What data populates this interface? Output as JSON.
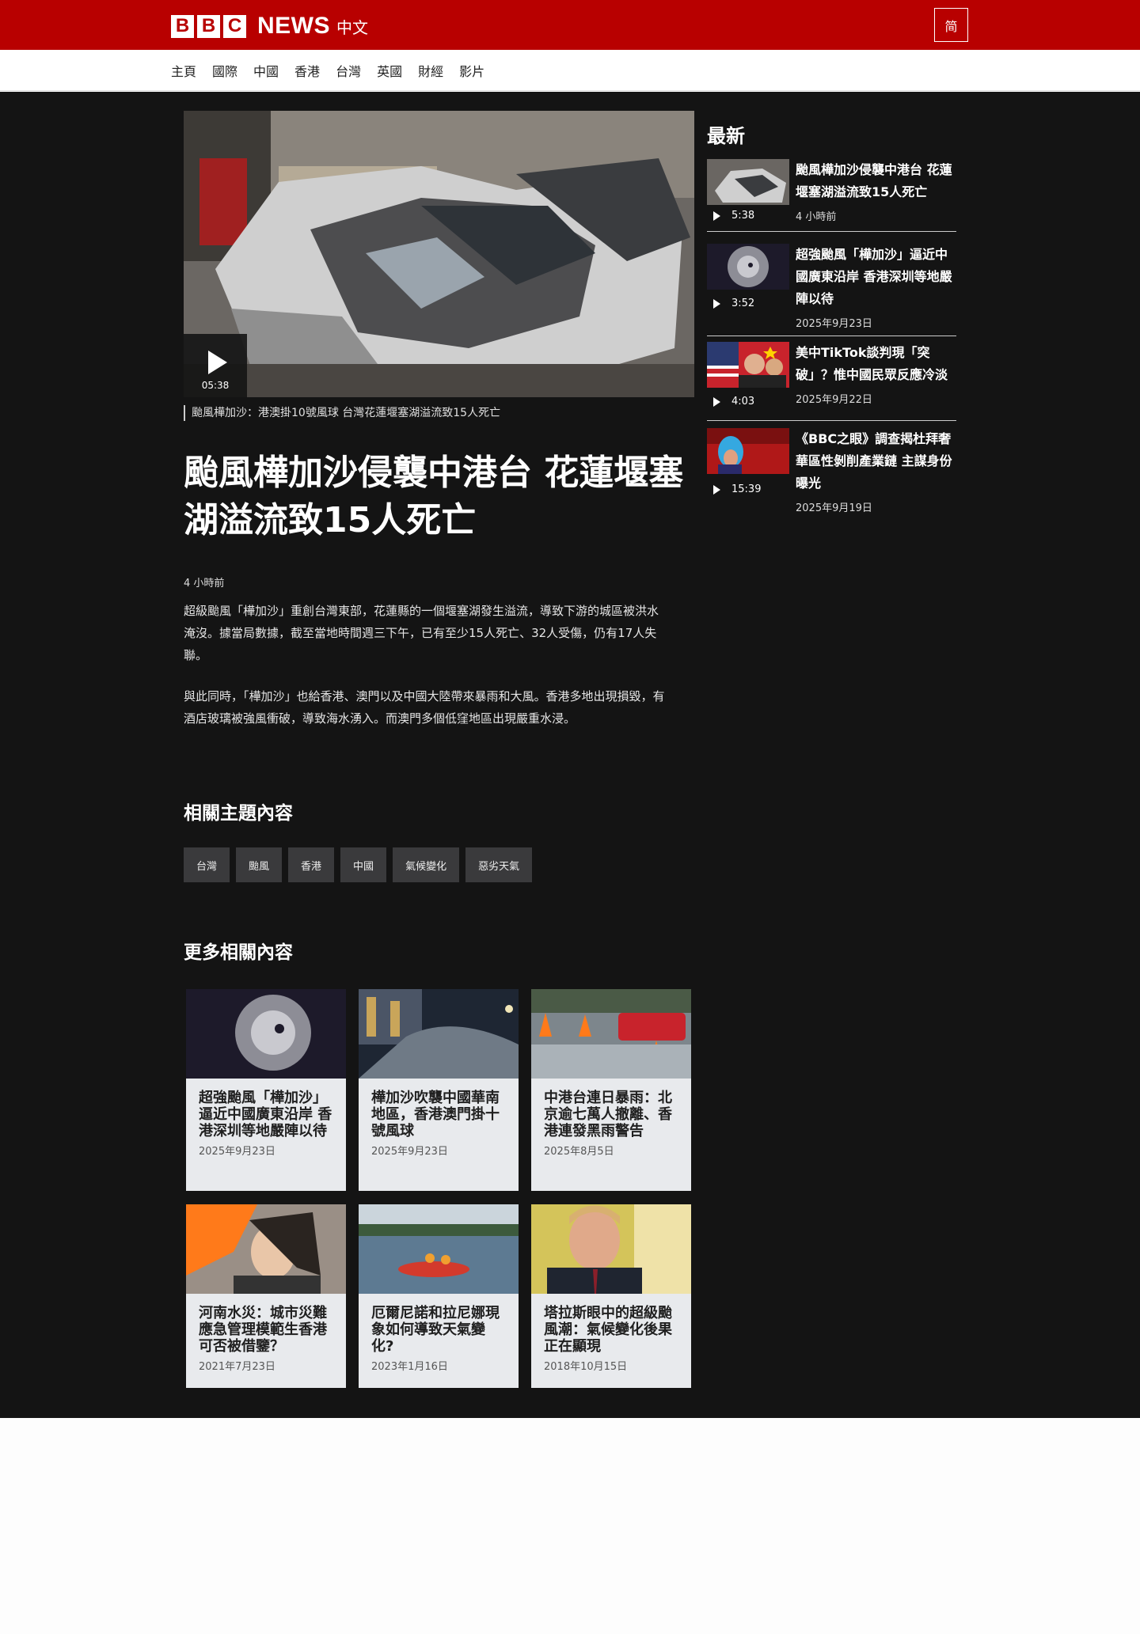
{
  "header": {
    "logo_letters": [
      "B",
      "B",
      "C"
    ],
    "logo_news": "NEWS",
    "logo_lang": "中文",
    "script_toggle": "简"
  },
  "nav": {
    "items": [
      "主頁",
      "國際",
      "中國",
      "香港",
      "台灣",
      "英國",
      "財經",
      "影片"
    ]
  },
  "hero": {
    "duration": "05:38",
    "caption": "颱風樺加沙：港澳掛10號風球 台灣花蓮堰塞湖溢流致15人死亡"
  },
  "article": {
    "headline": "颱風樺加沙侵襲中港台 花蓮堰塞湖溢流致15人死亡",
    "timestamp": "4 小時前",
    "paragraphs": [
      "超級颱風「樺加沙」重創台灣東部，花蓮縣的一個堰塞湖發生溢流，導致下游的城區被洪水淹沒。據當局數據，截至當地時間週三下午，已有至少15人死亡、32人受傷，仍有17人失聯。",
      "與此同時，「樺加沙」也給香港、澳門以及中國大陸帶來暴雨和大風。香港多地出現損毀，有酒店玻璃被強風衝破，導致海水湧入。而澳門多個低窪地區出現嚴重水浸。"
    ]
  },
  "topics": {
    "title": "相關主題內容",
    "tags": [
      "台灣",
      "颱風",
      "香港",
      "中國",
      "氣候變化",
      "惡劣天氣"
    ]
  },
  "more": {
    "title": "更多相關內容",
    "cards": [
      {
        "title": "超強颱風「樺加沙」逼近中國廣東沿岸 香港深圳等地嚴陣以待",
        "date": "2025年9月23日"
      },
      {
        "title": "樺加沙吹襲中國華南地區，香港澳門掛十號風球",
        "date": "2025年9月23日"
      },
      {
        "title": "中港台連日暴雨：北京逾七萬人撤離、香港連發黑雨警告",
        "date": "2025年8月5日"
      },
      {
        "title": "河南水災：城市災難應急管理模範生香港可否被借鑒？",
        "date": "2021年7月23日"
      },
      {
        "title": "厄爾尼諾和拉尼娜現象如何導致天氣變化?",
        "date": "2023年1月16日"
      },
      {
        "title": "塔拉斯眼中的超級颱風潮：氣候變化後果正在顯現",
        "date": "2018年10月15日"
      }
    ]
  },
  "sidebar": {
    "title": "最新",
    "items": [
      {
        "headline": "颱風樺加沙侵襲中港台 花蓮堰塞湖溢流致15人死亡",
        "duration": "5:38",
        "date": "4 小時前"
      },
      {
        "headline": "超強颱風「樺加沙」逼近中國廣東沿岸 香港深圳等地嚴陣以待",
        "duration": "3:52",
        "date": "2025年9月23日"
      },
      {
        "headline": "美中TikTok談判現「突破」？惟中國民眾反應冷淡",
        "duration": "4:03",
        "date": "2025年9月22日"
      },
      {
        "headline": "《BBC之眼》調查揭杜拜奢華區性剝削產業鏈 主謀身份曝光",
        "duration": "15:39",
        "date": "2025年9月19日"
      }
    ]
  },
  "colors": {
    "brand_red": "#b80000",
    "dark_bg": "#141414",
    "card_bg": "#e8eaed",
    "tag_bg": "#3a3a3c"
  }
}
